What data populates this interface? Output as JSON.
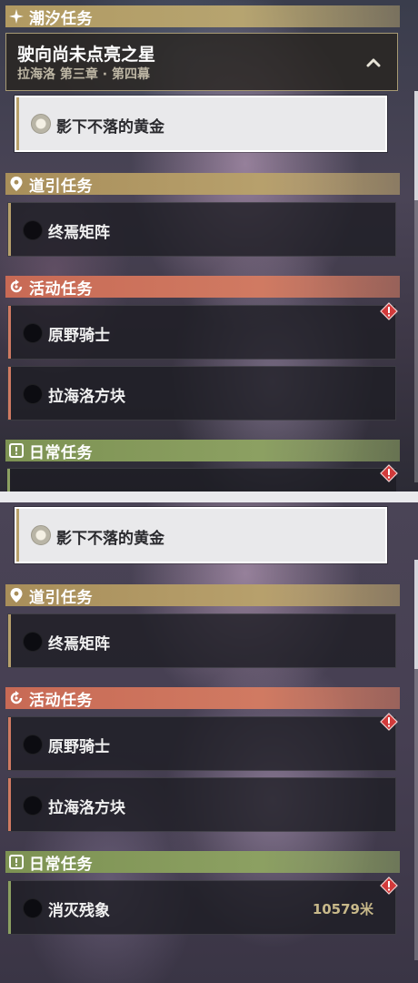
{
  "top_panel": {
    "sections": {
      "tide": "潮汐任务",
      "guide": "道引任务",
      "event": "活动任务",
      "daily": "日常任务"
    },
    "main_quest": {
      "title": "驶向尚未点亮之星",
      "subtitle": "拉海洛 第三章 · 第四幕"
    },
    "tracked_quest": "影下不落的黄金",
    "guide_quests": [
      "终焉矩阵"
    ],
    "event_quests": [
      "原野骑士",
      "拉海洛方块"
    ]
  },
  "bottom_panel": {
    "sections": {
      "guide": "道引任务",
      "event": "活动任务",
      "daily": "日常任务"
    },
    "tracked_quest": "影下不落的黄金",
    "guide_quests": [
      "终焉矩阵"
    ],
    "event_quests": [
      "原野骑士",
      "拉海洛方块"
    ],
    "daily_quests": [
      {
        "name": "消灭残象",
        "distance": "10579米"
      }
    ]
  },
  "icons": {
    "tide": "sparkle-icon",
    "guide": "location-pin-icon",
    "event": "refresh-icon",
    "daily": "exclamation-box-icon",
    "alert": "warning-diamond-icon",
    "collapse": "chevron-up-icon"
  },
  "colors": {
    "tide_band": "#b6a470",
    "guide_band": "#b7a06c",
    "event_band": "#d07a62",
    "daily_band": "#8ca062",
    "alert_red": "#d23a3a",
    "distance_text": "#c8b98a"
  }
}
